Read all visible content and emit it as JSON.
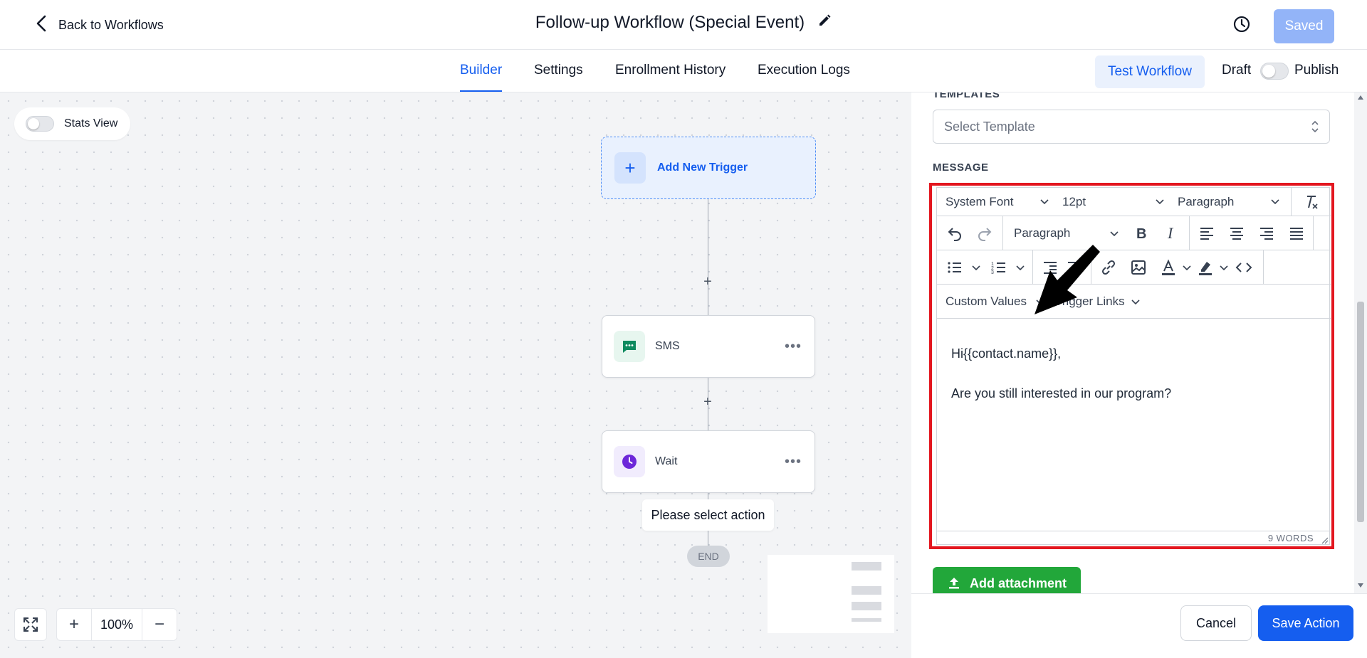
{
  "header": {
    "back_label": "Back to Workflows",
    "title": "Follow-up Workflow (Special Event)",
    "saved_label": "Saved"
  },
  "tabs": {
    "items": [
      {
        "label": "Builder",
        "active": true
      },
      {
        "label": "Settings",
        "active": false
      },
      {
        "label": "Enrollment History",
        "active": false
      },
      {
        "label": "Execution Logs",
        "active": false
      }
    ],
    "test_workflow": "Test Workflow",
    "draft": "Draft",
    "publish": "Publish"
  },
  "canvas": {
    "stats_view": "Stats View",
    "add_trigger": "Add New Trigger",
    "nodes": [
      {
        "label": "SMS",
        "icon": "sms-icon",
        "icon_color": "#0e8a5f"
      },
      {
        "label": "Wait",
        "icon": "clock-icon",
        "icon_color": "#6d28d9"
      }
    ],
    "tooltip": "Please select action",
    "end": "END",
    "zoom": "100%"
  },
  "panel": {
    "templates_label": "TEMPLATES",
    "template_placeholder": "Select Template",
    "message_label": "MESSAGE",
    "editor": {
      "font": "System Font",
      "size": "12pt",
      "block_format": "Paragraph",
      "block_format_2": "Paragraph",
      "custom_values": "Custom Values",
      "trigger_links": "Trigger Links",
      "body_line1": "Hi{{contact.name}},",
      "body_line2": "Are you still interested in our program?",
      "word_count": "9 WORDS"
    },
    "add_attachment": "Add attachment",
    "cancel": "Cancel",
    "save_action": "Save Action"
  },
  "colors": {
    "accent": "#155eef",
    "highlight_border": "#e3161f",
    "attach_green": "#22a73a",
    "saved_disabled": "#93b4f8"
  }
}
